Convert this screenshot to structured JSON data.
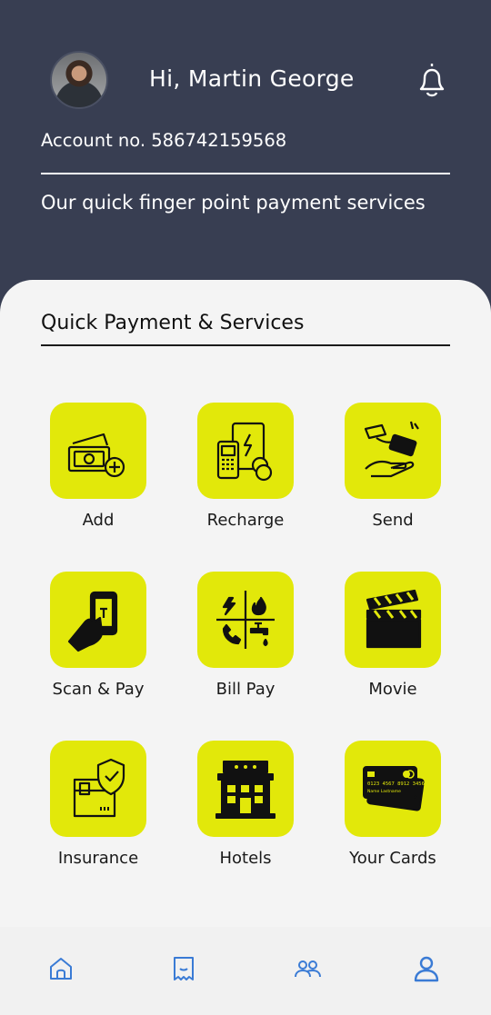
{
  "header": {
    "greeting": "Hi, Martin George",
    "account": "Account no. 586742159568",
    "tagline": "Our quick finger point payment services"
  },
  "section": {
    "title": "Quick Payment & Services"
  },
  "services": [
    {
      "label": "Add",
      "icon": "cash-add-icon"
    },
    {
      "label": "Recharge",
      "icon": "mobile-recharge-icon"
    },
    {
      "label": "Send",
      "icon": "send-money-icon"
    },
    {
      "label": "Scan & Pay",
      "icon": "scan-pay-icon"
    },
    {
      "label": "Bill Pay",
      "icon": "utility-bills-icon"
    },
    {
      "label": "Movie",
      "icon": "clapperboard-icon"
    },
    {
      "label": "Insurance",
      "icon": "insurance-shield-icon"
    },
    {
      "label": "Hotels",
      "icon": "hotel-building-icon"
    },
    {
      "label": "Your Cards",
      "icon": "credit-cards-icon"
    }
  ],
  "card_text": {
    "number": "0123 4567 8912 3456",
    "name": "Name Lastname"
  },
  "nav": [
    {
      "icon": "home-icon"
    },
    {
      "icon": "receipt-icon"
    },
    {
      "icon": "users-icon"
    },
    {
      "icon": "profile-icon"
    }
  ],
  "colors": {
    "header_bg": "#383e52",
    "tile": "#e2e80a",
    "panel": "#f4f4f4",
    "nav_accent": "#3a7bd5"
  }
}
